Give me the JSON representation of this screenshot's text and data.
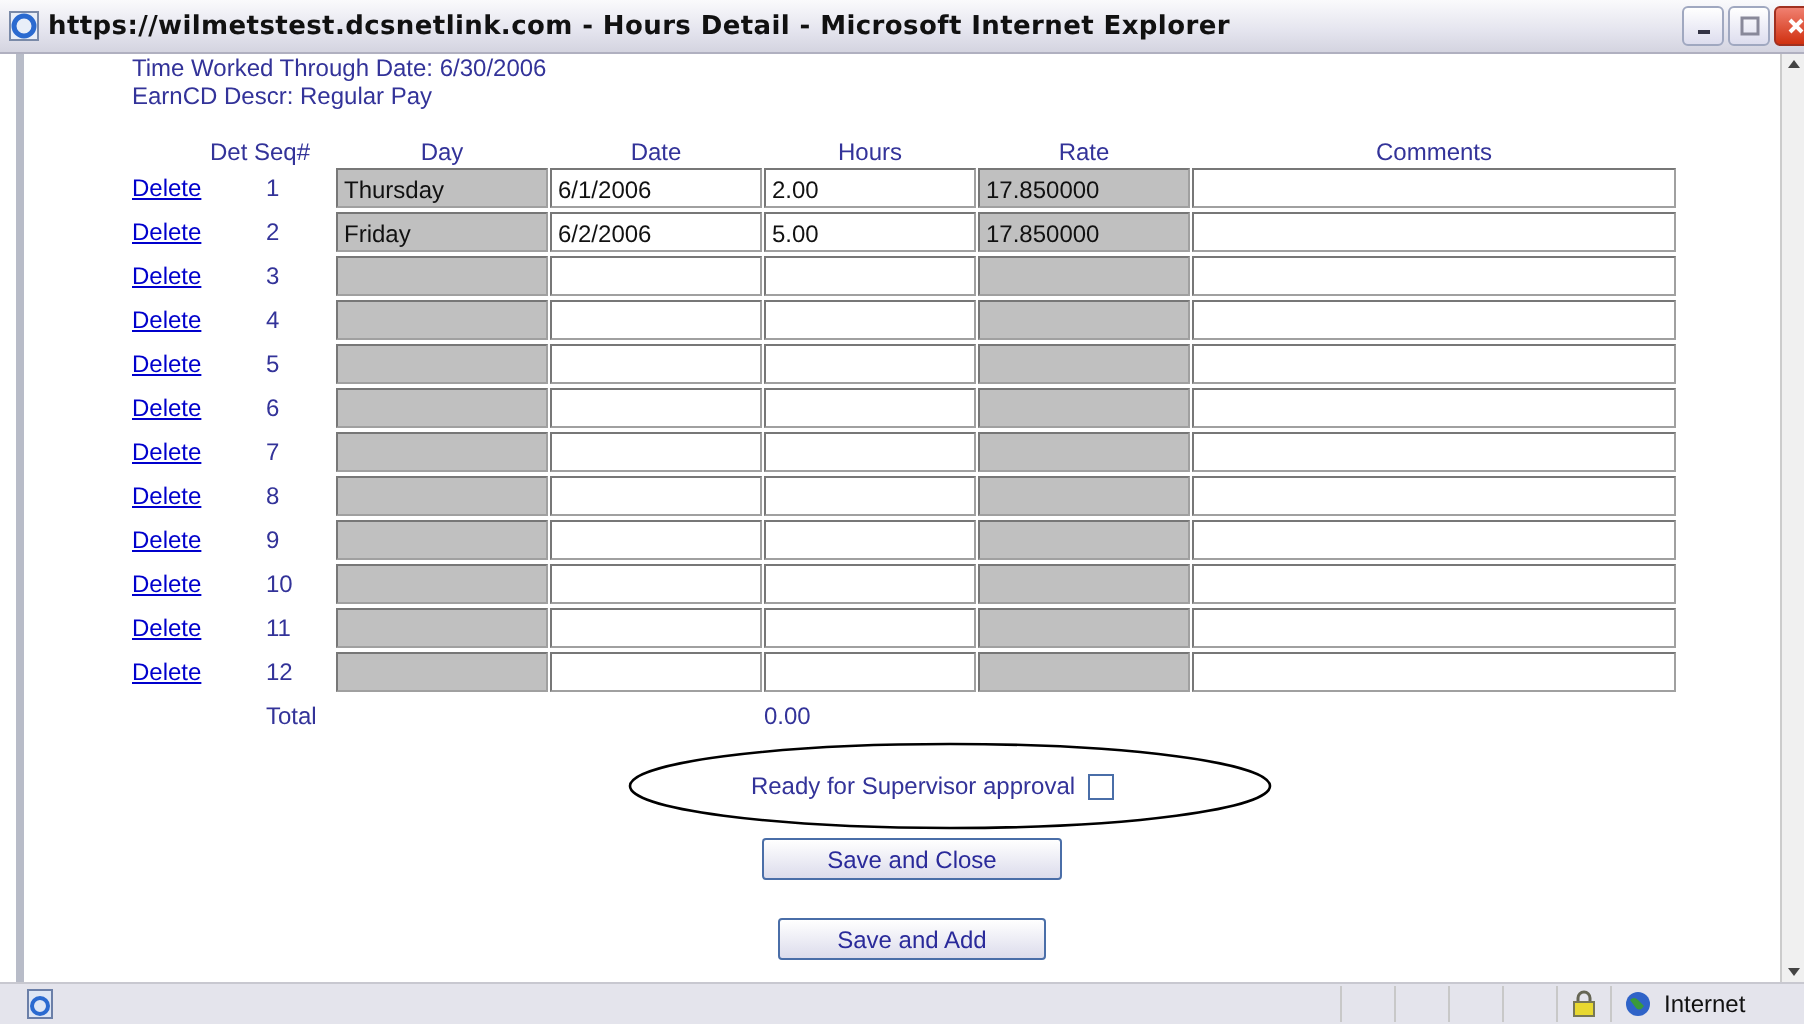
{
  "window": {
    "title": "https://wilmetstest.dcsnetlink.com - Hours Detail - Microsoft Internet Explorer"
  },
  "info": [
    "Time Worked Through Date: 6/30/2006",
    "EarnCD Descr: Regular Pay"
  ],
  "columns": [
    {
      "label": "Det Seq#",
      "kind": "seq"
    },
    {
      "label": "Day",
      "kind": "field",
      "readonly": true
    },
    {
      "label": "Date",
      "kind": "field",
      "readonly": false
    },
    {
      "label": "Hours",
      "kind": "field",
      "readonly": false
    },
    {
      "label": "Rate",
      "kind": "field",
      "readonly": true
    },
    {
      "label": "Comments",
      "kind": "field",
      "readonly": false
    }
  ],
  "rows": [
    {
      "link": "Delete",
      "seq": "1",
      "cells": [
        "Thursday",
        "6/1/2006",
        "2.00",
        "17.850000",
        null
      ]
    },
    {
      "link": "Delete",
      "seq": "2",
      "cells": [
        "Friday",
        "6/2/2006",
        "5.00",
        "17.850000",
        null
      ]
    },
    {
      "link": "Delete",
      "seq": "3",
      "cells": [
        null,
        null,
        null,
        null,
        null
      ]
    },
    {
      "link": "Delete",
      "seq": "4",
      "cells": [
        null,
        null,
        null,
        null,
        null
      ]
    },
    {
      "link": "Delete",
      "seq": "5",
      "cells": [
        null,
        null,
        null,
        null,
        null
      ]
    },
    {
      "link": "Delete",
      "seq": "6",
      "cells": [
        null,
        null,
        null,
        null,
        null
      ]
    },
    {
      "link": "Delete",
      "seq": "7",
      "cells": [
        null,
        null,
        null,
        null,
        null
      ]
    },
    {
      "link": "Delete",
      "seq": "8",
      "cells": [
        null,
        null,
        null,
        null,
        null
      ]
    },
    {
      "link": "Delete",
      "seq": "9",
      "cells": [
        null,
        null,
        null,
        null,
        null
      ]
    },
    {
      "link": "Delete",
      "seq": "10",
      "cells": [
        null,
        null,
        null,
        null,
        null
      ]
    },
    {
      "link": "Delete",
      "seq": "11",
      "cells": [
        null,
        null,
        null,
        null,
        null
      ]
    },
    {
      "link": "Delete",
      "seq": "12",
      "cells": [
        null,
        null,
        null,
        null,
        null
      ]
    }
  ],
  "total": {
    "label": "Total",
    "hours": "0.00"
  },
  "approval": {
    "label": "Ready for Supervisor approval",
    "checked": false
  },
  "buttons": [
    "Save and Close",
    "Save and Add"
  ],
  "status_bar": {
    "zone": "Internet"
  }
}
